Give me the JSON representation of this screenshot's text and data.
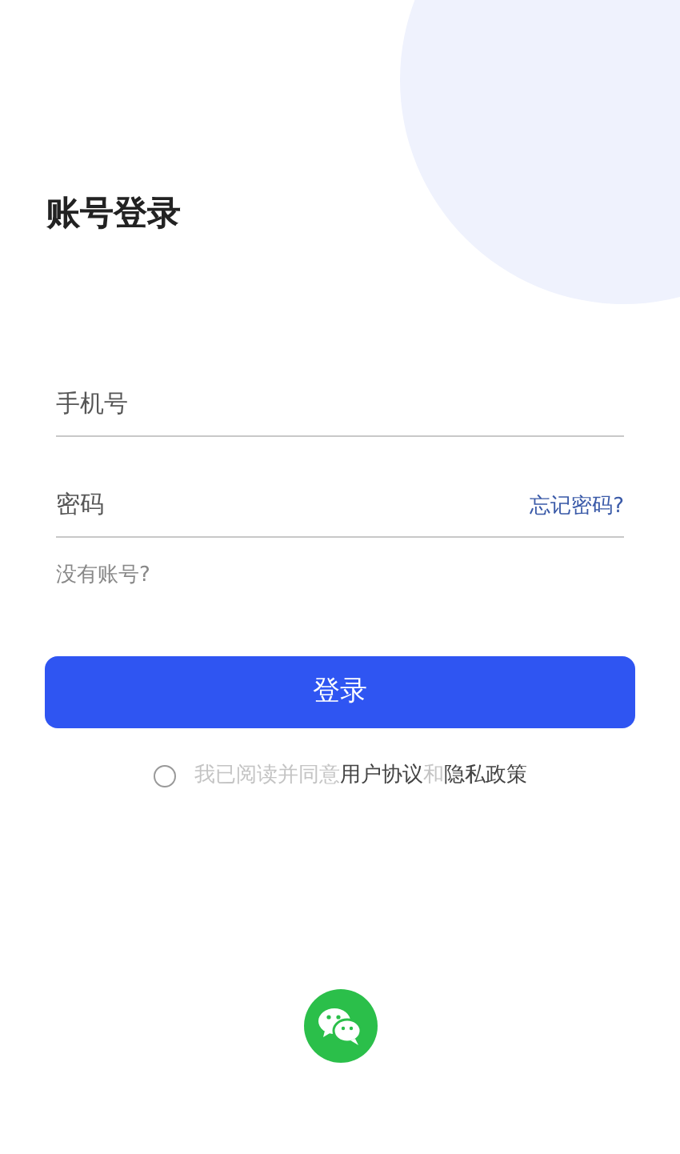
{
  "title": "账号登录",
  "phone_field": {
    "placeholder": "手机号"
  },
  "password_field": {
    "placeholder": "密码"
  },
  "forgot_password": "忘记密码?",
  "register_link": "没有账号?",
  "login_button": "登录",
  "agreement": {
    "checked": false,
    "parts": [
      {
        "text": "我已阅读并同意",
        "kind": "plain"
      },
      {
        "text": "用户协议",
        "kind": "link"
      },
      {
        "text": "和",
        "kind": "plain"
      },
      {
        "text": "隐私政策",
        "kind": "link"
      }
    ]
  }
}
